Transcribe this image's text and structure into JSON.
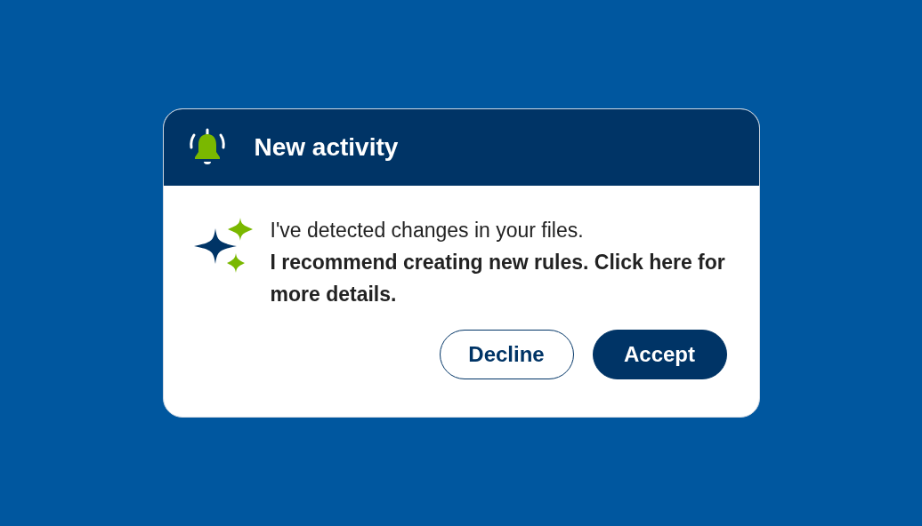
{
  "notification": {
    "title": "New activity",
    "message": "I've detected changes in your files.\n**I recommend creating new rules. Click here for more details.**",
    "buttons": [
      {
        "label": "Decline",
        "kind": "secondary"
      },
      {
        "label": "Accept",
        "kind": "primary"
      }
    ]
  }
}
